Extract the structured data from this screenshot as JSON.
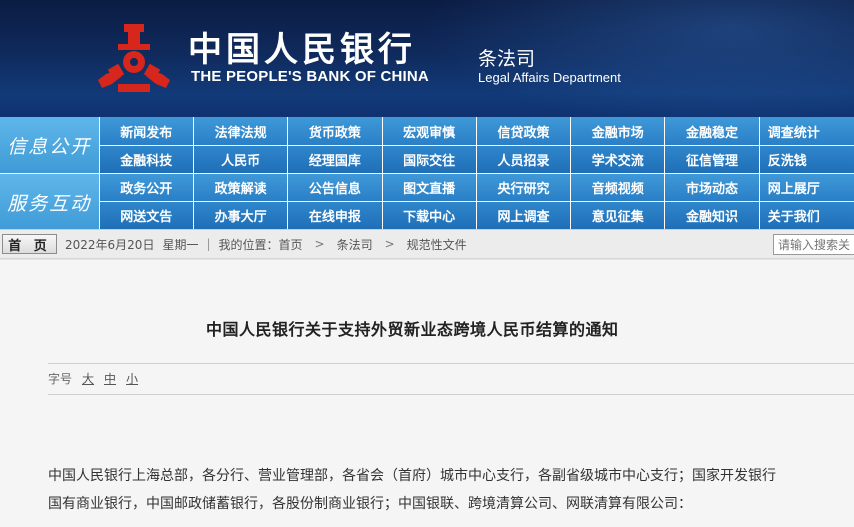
{
  "header": {
    "bank_name_cn": "中国人民银行",
    "bank_name_en": "THE PEOPLE'S BANK OF CHINA",
    "dept_cn": "条法司",
    "dept_en": "Legal Affairs Department",
    "logo": "pboc-logo-icon",
    "colors": {
      "bg_dark": "#0b1c43",
      "logo_red": "#d7261b"
    }
  },
  "nav": {
    "groups": [
      {
        "label": "信息公开",
        "rows": [
          [
            "新闻发布",
            "法律法规",
            "货币政策",
            "宏观审慎",
            "信贷政策",
            "金融市场",
            "金融稳定",
            "调查统计"
          ],
          [
            "金融科技",
            "人民币",
            "经理国库",
            "国际交往",
            "人员招录",
            "学术交流",
            "征信管理",
            "反洗钱"
          ]
        ]
      },
      {
        "label": "服务互动",
        "rows": [
          [
            "政务公开",
            "政策解读",
            "公告信息",
            "图文直播",
            "央行研究",
            "音频视频",
            "市场动态",
            "网上展厅"
          ],
          [
            "网送文告",
            "办事大厅",
            "在线申报",
            "下载中心",
            "网上调查",
            "意见征集",
            "金融知识",
            "关于我们"
          ]
        ]
      }
    ],
    "colors": {
      "nav_blue": "#2a7fc6",
      "label_blue": "#4aa6df"
    }
  },
  "crumb": {
    "home_label": "首 页",
    "date": "2022年6月20日",
    "weekday": "星期一",
    "location_prefix": "我的位置：首页",
    "arrow": ">",
    "level1": "条法司",
    "level2": "规范性文件",
    "search_placeholder": "请输入搜索关"
  },
  "article": {
    "title": "中国人民银行关于支持外贸新业态跨境人民币结算的通知",
    "fontsize_label": "字号",
    "fontsize_options": [
      "大",
      "中",
      "小"
    ],
    "paragraph_line1": "中国人民银行上海总部，各分行、营业管理部，各省会（首府）城市中心支行，各副省级城市中心支行；国家开发银行",
    "paragraph_line2": "国有商业银行，中国邮政储蓄银行，各股份制商业银行；中国银联、跨境清算公司、网联清算有限公司："
  }
}
